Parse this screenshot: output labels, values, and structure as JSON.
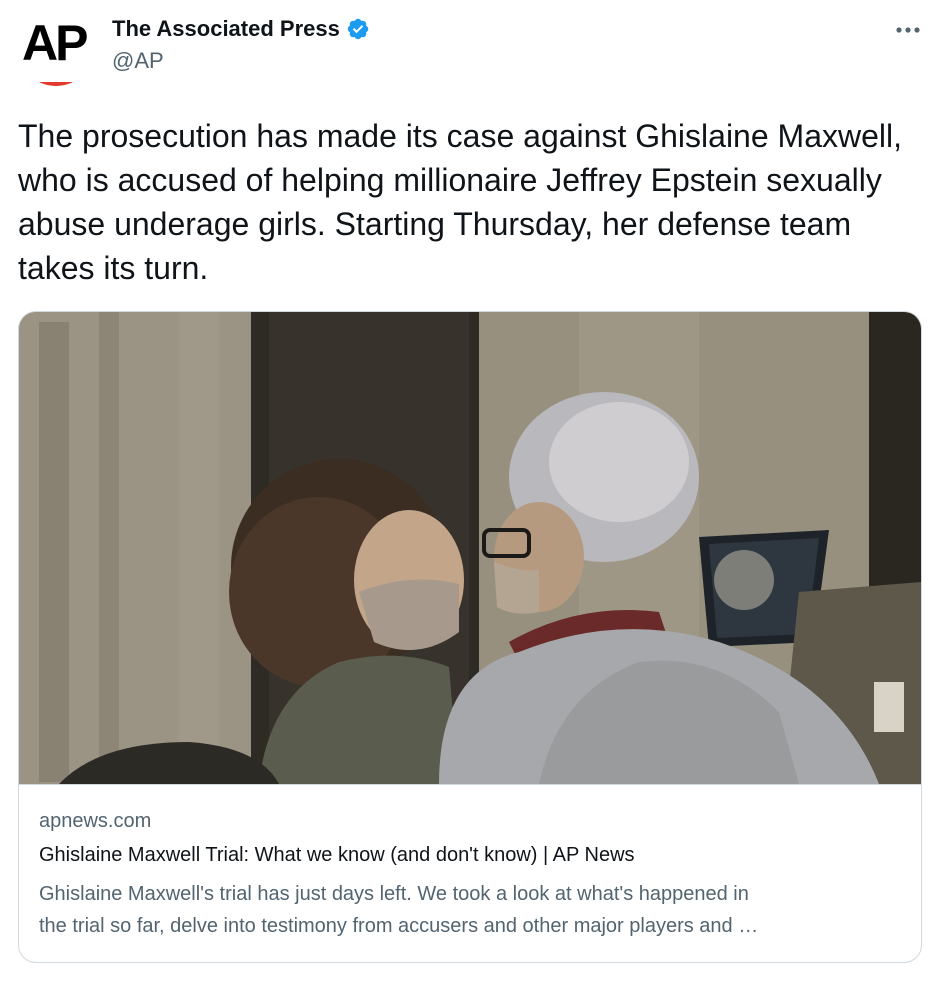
{
  "author": {
    "display_name": "The Associated Press",
    "handle": "@AP",
    "verified": true,
    "avatar_logo_text": "AP"
  },
  "tweet": {
    "text": "The prosecution has made its case against Ghislaine Maxwell, who is accused of helping millionaire Jeffrey Epstein sexually abuse underage girls. Starting Thursday, her defense team takes its turn."
  },
  "card": {
    "domain": "apnews.com",
    "title": "Ghislaine Maxwell Trial: What we know (and don't know) | AP News",
    "description_line1": "Ghislaine Maxwell's trial has just days left. We took a look at what's happened in",
    "description_line2": "the trial so far, delve into testimony from accusers and other major players and …"
  },
  "icons": {
    "verified": "verified-badge-icon",
    "more": "more-options-icon"
  },
  "colors": {
    "verified_blue": "#1d9bf0",
    "text_primary": "#0f1419",
    "text_secondary": "#536471",
    "border": "#cfd9de",
    "ap_red": "#e4392d"
  }
}
